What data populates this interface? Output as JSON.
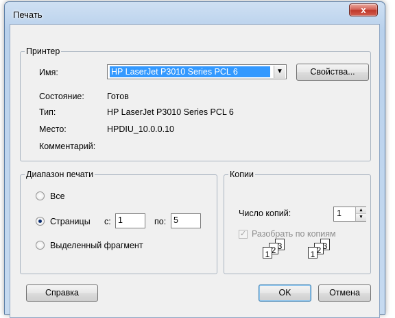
{
  "window": {
    "title": "Печать",
    "close_glyph": "x"
  },
  "printer": {
    "group_label": "Принтер",
    "name_label": "Имя:",
    "selected_printer": "HP LaserJet P3010 Series PCL 6",
    "properties_button": "Свойства...",
    "status_label": "Состояние:",
    "status_value": "Готов",
    "type_label": "Тип:",
    "type_value": "HP LaserJet P3010 Series PCL 6",
    "location_label": "Место:",
    "location_value": "HPDIU_10.0.0.10",
    "comment_label": "Комментарий:"
  },
  "range": {
    "group_label": "Диапазон печати",
    "all_label": "Все",
    "pages_label": "Страницы",
    "from_label": "с:",
    "from_value": "1",
    "to_label": "по:",
    "to_value": "5",
    "selection_label": "Выделенный фрагмент",
    "selected_option": "pages"
  },
  "copies": {
    "group_label": "Копии",
    "count_label": "Число копий:",
    "count_value": "1",
    "collate_label": "Разобрать по копиям",
    "collate_checked": true,
    "collate_enabled": false,
    "collate_set_1": [
      "1",
      "2",
      "3"
    ],
    "collate_set_2": [
      "1",
      "2",
      "3"
    ]
  },
  "buttons": {
    "help": "Справка",
    "ok": "OK",
    "cancel": "Отмена"
  },
  "icons": {
    "dropdown": "chevron-down-icon",
    "spin_up": "spin-up-icon",
    "spin_down": "spin-down-icon",
    "collate": "collate-pages-icon"
  }
}
